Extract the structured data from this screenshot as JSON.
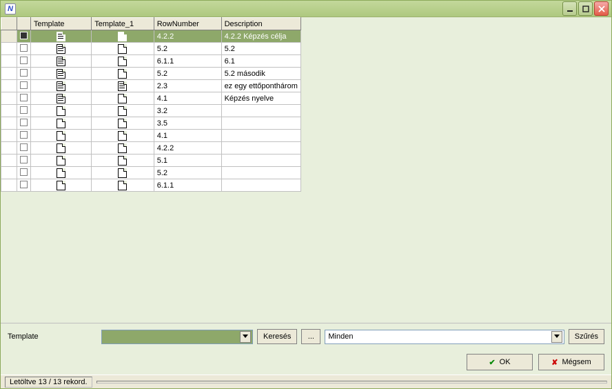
{
  "headers": {
    "template": "Template",
    "template1": "Template_1",
    "rownum": "RowNumber",
    "desc": "Description"
  },
  "rows": [
    {
      "sel": true,
      "tpl": "filled",
      "tpl1": "blank",
      "row": "4.2.2",
      "desc": "4.2.2 Képzés célja"
    },
    {
      "sel": false,
      "tpl": "filled",
      "tpl1": "blank",
      "row": "5.2",
      "desc": "5.2"
    },
    {
      "sel": false,
      "tpl": "filled",
      "tpl1": "blank",
      "row": "6.1.1",
      "desc": "6.1"
    },
    {
      "sel": false,
      "tpl": "filled",
      "tpl1": "blank",
      "row": "5.2",
      "desc": "5.2 második"
    },
    {
      "sel": false,
      "tpl": "filled",
      "tpl1": "filled",
      "row": "2.3",
      "desc": "ez egy ettőponthárom"
    },
    {
      "sel": false,
      "tpl": "filled",
      "tpl1": "blank",
      "row": "4.1",
      "desc": "Képzés nyelve"
    },
    {
      "sel": false,
      "tpl": "blank",
      "tpl1": "blank",
      "row": "3.2",
      "desc": ""
    },
    {
      "sel": false,
      "tpl": "blank",
      "tpl1": "blank",
      "row": "3.5",
      "desc": ""
    },
    {
      "sel": false,
      "tpl": "blank",
      "tpl1": "blank",
      "row": "4.1",
      "desc": ""
    },
    {
      "sel": false,
      "tpl": "blank",
      "tpl1": "blank",
      "row": "4.2.2",
      "desc": ""
    },
    {
      "sel": false,
      "tpl": "blank",
      "tpl1": "blank",
      "row": "5.1",
      "desc": ""
    },
    {
      "sel": false,
      "tpl": "blank",
      "tpl1": "blank",
      "row": "5.2",
      "desc": ""
    },
    {
      "sel": false,
      "tpl": "blank",
      "tpl1": "blank",
      "row": "6.1.1",
      "desc": ""
    }
  ],
  "toolbar": {
    "template_label": "Template",
    "template_value": "",
    "search_label": "Keresés",
    "ellipsis": "...",
    "filter_value": "Minden",
    "filter_button": "Szűrés"
  },
  "buttons": {
    "ok": "OK",
    "cancel": "Mégsem"
  },
  "status": "Letöltve 13 / 13 rekord."
}
